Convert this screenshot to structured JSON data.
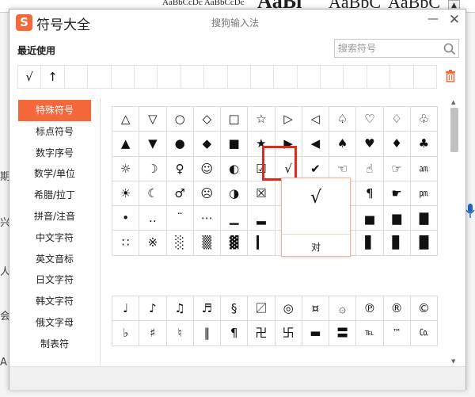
{
  "background": {
    "top_text": [
      "AaBbCcDc AaBbCcDc",
      "AaBl",
      "AaBbC",
      "AaBbC"
    ],
    "scroll_arrow": "▲",
    "left_fragments": [
      "期",
      "兴",
      "人",
      "会",
      "A"
    ]
  },
  "window": {
    "app_title": "符号大全",
    "ime_title": "搜狗输入法",
    "logo_letter": "S",
    "minimize": "—",
    "close": "✕",
    "accent": "#f5683b"
  },
  "recent": {
    "label": "最近使用",
    "symbols": [
      "√",
      "↑",
      "",
      "",
      "",
      "",
      "",
      "",
      "",
      "",
      "",
      "",
      "",
      "",
      "",
      "",
      "",
      ""
    ]
  },
  "search": {
    "placeholder": "搜索符号"
  },
  "categories": [
    {
      "label": "特殊符号",
      "selected": true
    },
    {
      "label": "标点符号"
    },
    {
      "label": "数字序号"
    },
    {
      "label": "数学/单位"
    },
    {
      "label": "希腊/拉丁"
    },
    {
      "label": "拼音/注音"
    },
    {
      "label": "中文字符"
    },
    {
      "label": "英文音标"
    },
    {
      "label": "日文字符"
    },
    {
      "label": "韩文字符"
    },
    {
      "label": "俄文字母"
    },
    {
      "label": "制表符"
    }
  ],
  "symbols_grid1": [
    [
      "△",
      "▽",
      "○",
      "◇",
      "□",
      "☆",
      "▷",
      "◁",
      "♤",
      "♡",
      "♢",
      "♧"
    ],
    [
      "▲",
      "▼",
      "●",
      "◆",
      "■",
      "★",
      "▶",
      "◀",
      "♠",
      "♥",
      "♦",
      "♣"
    ],
    [
      "☼",
      "☽",
      "♀",
      "☺",
      "◐",
      "☑",
      "√",
      "✔",
      "☜",
      "☝",
      "☞",
      "㏂"
    ],
    [
      "☀",
      "☾",
      "♂",
      "☹",
      "◑",
      "☒",
      "☓",
      "",
      "",
      "¶",
      "☛",
      "㏘"
    ],
    [
      "•",
      "‥",
      "¨",
      "⋯",
      "▁",
      "▂",
      "▃",
      "",
      "",
      "▅",
      "▆",
      "▇"
    ],
    [
      "∷",
      "※",
      "░",
      "▒",
      "▓",
      "▎",
      "▍",
      "▌",
      "",
      "▋",
      "▊",
      "█"
    ]
  ],
  "symbols_grid2": [
    [
      "♩",
      "♪",
      "♫",
      "♬",
      "§",
      "〼",
      "◎",
      "¤",
      "۞",
      "℗",
      "®",
      "©"
    ],
    [
      "♭",
      "♯",
      "♮",
      "‖",
      "¶",
      "卍",
      "卐",
      "▬",
      "〓",
      "℡",
      "™",
      "㏇"
    ]
  ],
  "popup": {
    "symbol": "√",
    "name": "对"
  }
}
